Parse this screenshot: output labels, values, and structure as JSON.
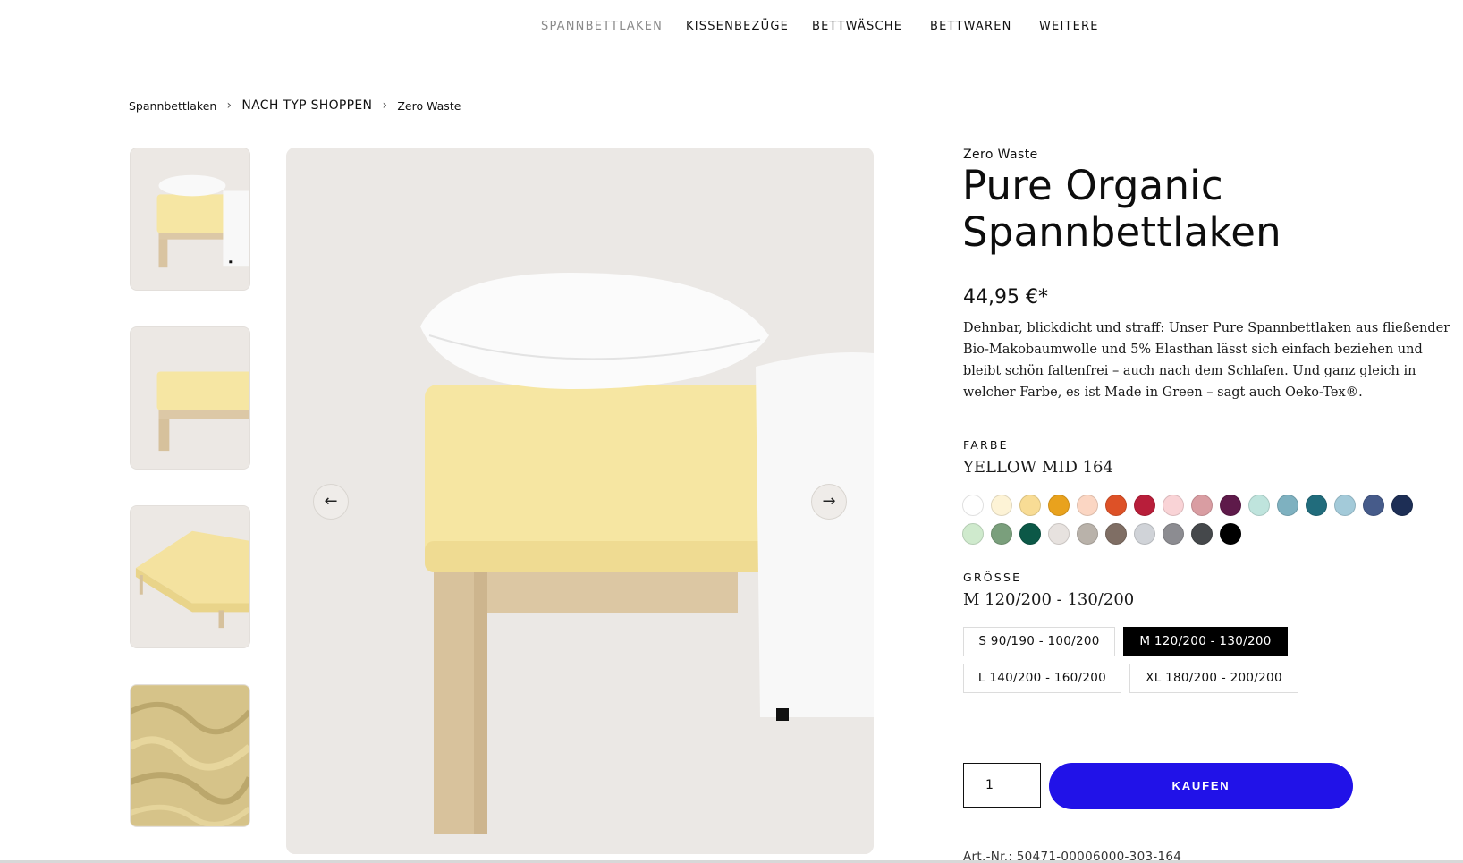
{
  "nav": {
    "items": [
      "SPANNBETTLAKEN",
      "KISSENBEZÜGE",
      "BETTWÄSCHE",
      "BETTWAREN",
      "WEITERE"
    ],
    "active": "SPANNBETTLAKEN"
  },
  "breadcrumb": [
    "Spannbettlaken",
    "NACH TYP SHOPPEN",
    "Zero Waste"
  ],
  "gallery": {
    "prev_icon": "←",
    "next_icon": "→"
  },
  "product": {
    "eyebrow": "Zero Waste",
    "title": "Pure Organic Spannbettlaken",
    "price": "44,95 €*",
    "description": "Dehnbar, blickdicht und straff: Unser Pure Spannbettlaken aus fließender Bio-Makobaumwolle und 5% Elasthan lässt sich einfach beziehen und bleibt schön faltenfrei – auch nach dem Schlafen. Und ganz gleich in welcher Farbe, es ist Made in Green – sagt auch Oeko-Tex®.",
    "color_label": "FARBE",
    "color_value": "YELLOW MID 164",
    "colors": [
      "#ffffff",
      "#fdf3d6",
      "#f8dc95",
      "#e9a21d",
      "#fbd6c3",
      "#dd5127",
      "#b81e3a",
      "#f9d3d6",
      "#d99da2",
      "#5e1a4a",
      "#bfe4dd",
      "#7eb1c0",
      "#216c7c",
      "#a3cad9",
      "#465b8a",
      "#1d2e55",
      "#cfeacd",
      "#7a9f7c",
      "#0c5847",
      "#e7e2df",
      "#b9b2aa",
      "#7f6e64",
      "#d0d3d8",
      "#8c8c91",
      "#45484b",
      "#000000"
    ],
    "size_label": "GRÖSSE",
    "size_value": "M 120/200 - 130/200",
    "sizes": [
      "S 90/190 - 100/200",
      "M 120/200 - 130/200",
      "L 140/200 - 160/200",
      "XL 180/200 - 200/200"
    ],
    "selected_size": "M 120/200 - 130/200",
    "quantity": "1",
    "buy_label": "KAUFEN",
    "article_number": "Art.-Nr.: 50471-00006000-303-164"
  }
}
